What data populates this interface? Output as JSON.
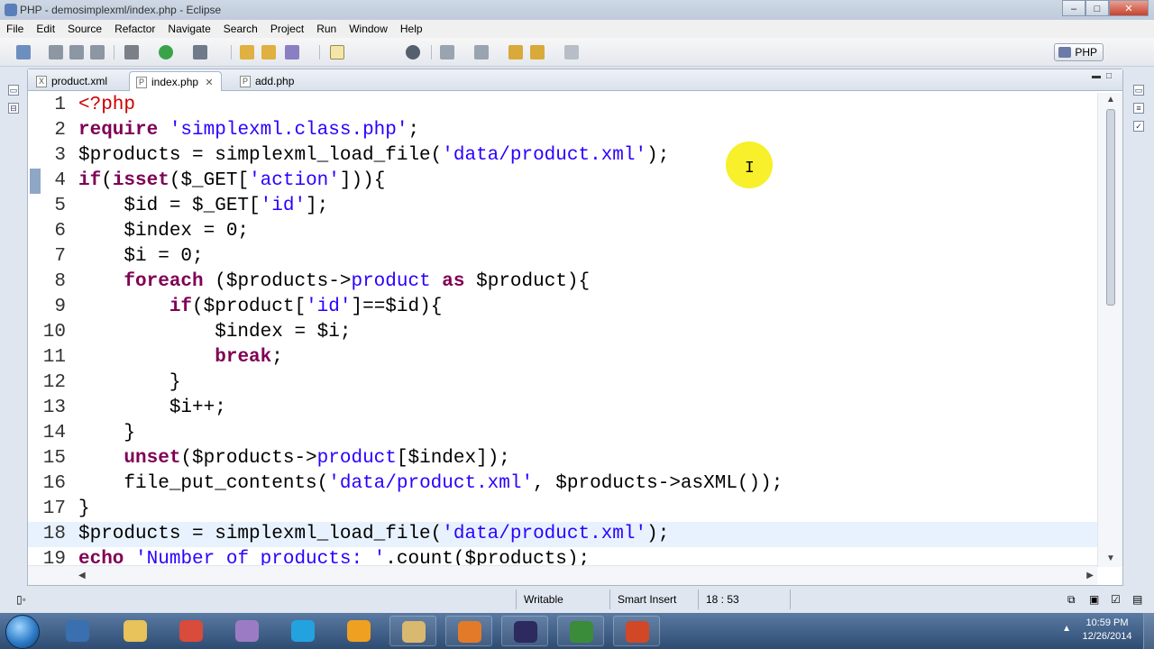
{
  "window": {
    "title": "PHP - demosimplexml/index.php - Eclipse",
    "min": "‒",
    "max": "□",
    "close": "✕"
  },
  "menu": [
    "File",
    "Edit",
    "Source",
    "Refactor",
    "Navigate",
    "Search",
    "Project",
    "Run",
    "Window",
    "Help"
  ],
  "perspective": {
    "label": "PHP"
  },
  "tabs": [
    {
      "label": "product.xml",
      "icon": "X"
    },
    {
      "label": "index.php",
      "icon": "P",
      "close": "✕"
    },
    {
      "label": "add.php",
      "icon": "P"
    }
  ],
  "code": {
    "current_line": 18,
    "lines": [
      [
        [
          "tag",
          "<?php"
        ]
      ],
      [
        [
          "kw",
          "require"
        ],
        [
          "",
          " "
        ],
        [
          "str",
          "'simplexml.class.php'"
        ],
        [
          "",
          ";"
        ]
      ],
      [
        [
          "",
          "$products = simplexml_load_file("
        ],
        [
          "str",
          "'data/product.xml'"
        ],
        [
          "",
          ");"
        ]
      ],
      [
        [
          "kw",
          "if"
        ],
        [
          "",
          "("
        ],
        [
          "kw",
          "isset"
        ],
        [
          "",
          "($_GET["
        ],
        [
          "str",
          "'action'"
        ],
        [
          "",
          "])){"
        ]
      ],
      [
        [
          "",
          "    $id = $_GET["
        ],
        [
          "str",
          "'id'"
        ],
        [
          "",
          "];"
        ]
      ],
      [
        [
          "",
          "    $index = 0;"
        ]
      ],
      [
        [
          "",
          "    $i = 0;"
        ]
      ],
      [
        [
          "",
          "    "
        ],
        [
          "kw",
          "foreach"
        ],
        [
          "",
          " ($products->"
        ],
        [
          "str",
          "product"
        ],
        [
          "",
          " "
        ],
        [
          "kw",
          "as"
        ],
        [
          "",
          " $product){"
        ]
      ],
      [
        [
          "",
          "        "
        ],
        [
          "kw",
          "if"
        ],
        [
          "",
          "($product["
        ],
        [
          "str",
          "'id'"
        ],
        [
          "",
          "]==$id){"
        ]
      ],
      [
        [
          "",
          "            $index = $i;"
        ]
      ],
      [
        [
          "",
          "            "
        ],
        [
          "kw",
          "break"
        ],
        [
          "",
          ";"
        ]
      ],
      [
        [
          "",
          "        }"
        ]
      ],
      [
        [
          "",
          "        $i++;"
        ]
      ],
      [
        [
          "",
          "    }"
        ]
      ],
      [
        [
          "",
          "    "
        ],
        [
          "kw",
          "unset"
        ],
        [
          "",
          "($products->"
        ],
        [
          "str",
          "product"
        ],
        [
          "",
          "[$index]);"
        ]
      ],
      [
        [
          "",
          "    file_put_contents("
        ],
        [
          "str",
          "'data/product.xml'"
        ],
        [
          "",
          ", $products->asXML());"
        ]
      ],
      [
        [
          "",
          "}"
        ]
      ],
      [
        [
          "",
          "$products = simplexml_load_file("
        ],
        [
          "str",
          "'data/product.xml'"
        ],
        [
          "",
          ");"
        ]
      ],
      [
        [
          "kw",
          "echo"
        ],
        [
          "",
          " "
        ],
        [
          "str",
          "'Number of products: '"
        ],
        [
          "",
          ".count($products);"
        ]
      ]
    ]
  },
  "status": {
    "writable": "Writable",
    "insert_mode": "Smart Insert",
    "position": "18 : 53"
  },
  "taskbar": {
    "apps": [
      {
        "name": "media-player",
        "color": "#3a6fb0"
      },
      {
        "name": "file-explorer",
        "color": "#e8c25a"
      },
      {
        "name": "chrome",
        "color": "#d94b3a"
      },
      {
        "name": "gimp",
        "color": "#9b7cc4"
      },
      {
        "name": "skype",
        "color": "#22a3e0"
      },
      {
        "name": "outlook",
        "color": "#f0a020"
      },
      {
        "name": "file-manager",
        "color": "#d9b870"
      },
      {
        "name": "firefox",
        "color": "#e27a2a"
      },
      {
        "name": "eclipse",
        "color": "#2c2a5e"
      },
      {
        "name": "camtasia",
        "color": "#3a8c3a"
      },
      {
        "name": "powerpoint",
        "color": "#d24726"
      }
    ],
    "time": "10:59 PM",
    "date": "12/26/2014"
  }
}
